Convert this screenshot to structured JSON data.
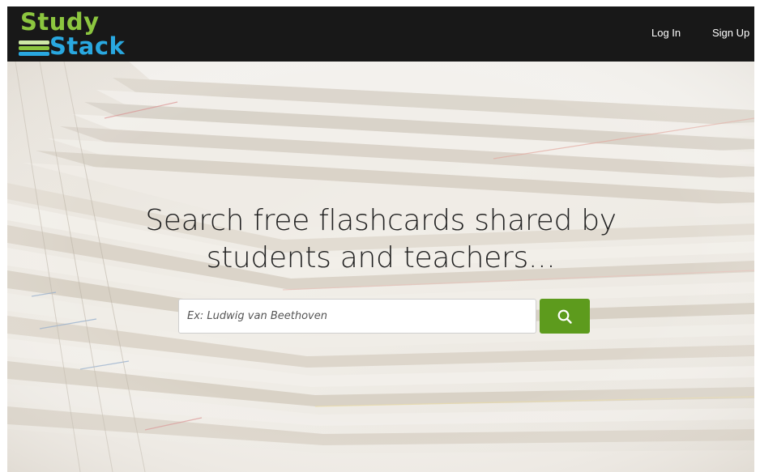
{
  "brand": {
    "word_top": "Study",
    "word_bottom": "Stack",
    "color_green": "#8cc63f",
    "color_blue": "#29a8e0",
    "bar_colors": [
      "#cfe9a7",
      "#8cc63f",
      "#29a8e0"
    ]
  },
  "nav": {
    "login_label": "Log In",
    "signup_label": "Sign Up",
    "background": "#181818"
  },
  "hero": {
    "title_line1": "Search free flashcards shared by",
    "title_line2": "students and teachers...",
    "background_description_icon": "paper-stack-photo"
  },
  "search": {
    "placeholder": "Ex: Ludwig van Beethoven",
    "value": "",
    "button_icon": "search-icon",
    "button_color": "#5d9b1d"
  }
}
